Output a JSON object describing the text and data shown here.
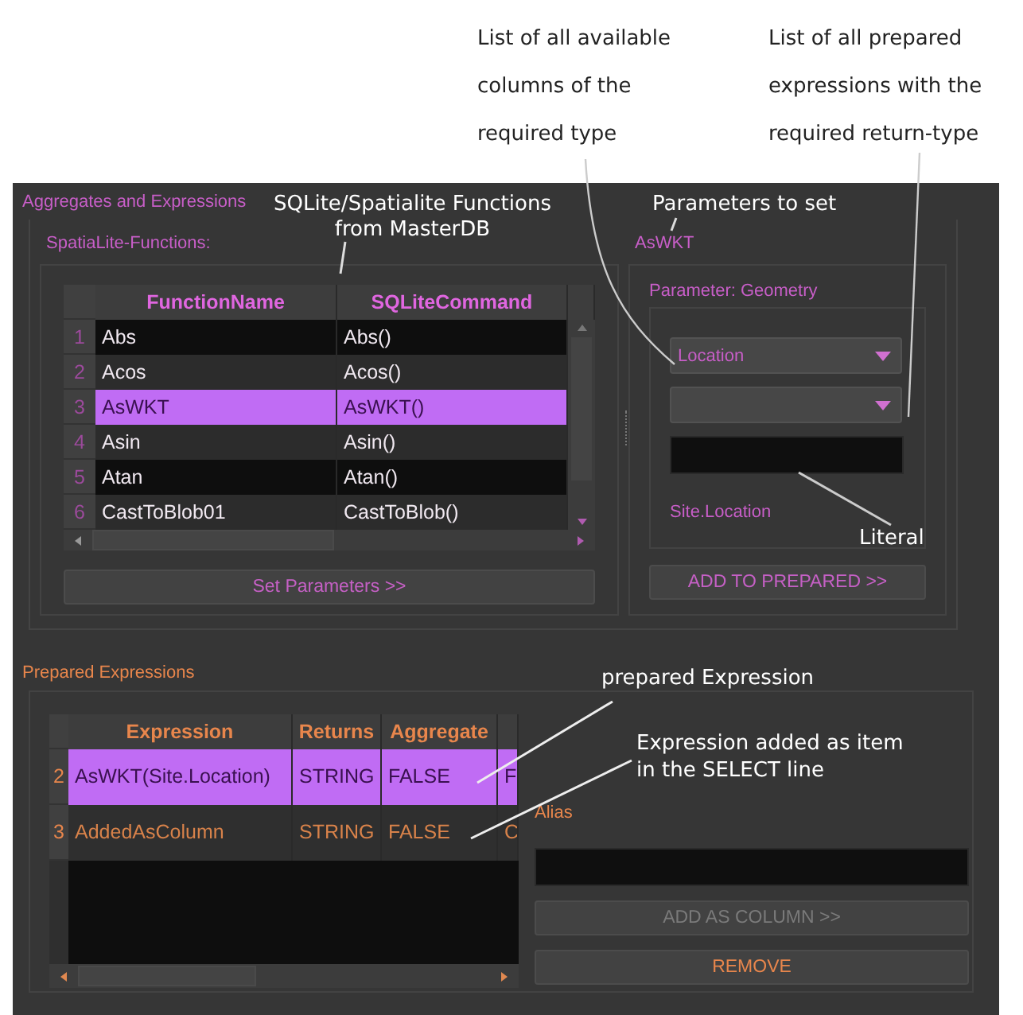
{
  "annotations": [
    {
      "lines": [
        "List of all available",
        "columns of the",
        "required type"
      ]
    },
    {
      "lines": [
        "List of all prepared",
        "expressions with the",
        "required return-type"
      ]
    },
    {
      "lines": [
        "SQLite/Spatialite Functions",
        "from MasterDB"
      ]
    },
    {
      "lines": [
        "Parameters to set"
      ]
    },
    {
      "lines": [
        "Literal"
      ]
    },
    {
      "lines": [
        "prepared Expression"
      ]
    },
    {
      "lines": [
        "Expression added as item",
        "in the SELECT line"
      ]
    }
  ],
  "window": {
    "title": "Aggregates and Expressions"
  },
  "functions": {
    "label": "SpatiaLite-Functions:",
    "columns": [
      "FunctionName",
      "SQLiteCommand"
    ],
    "rows": [
      {
        "num": "1",
        "name": "Abs",
        "command": "Abs()",
        "selected": false
      },
      {
        "num": "2",
        "name": "Acos",
        "command": "Acos()",
        "selected": false
      },
      {
        "num": "3",
        "name": "AsWKT",
        "command": "AsWKT()",
        "selected": true
      },
      {
        "num": "4",
        "name": "Asin",
        "command": "Asin()",
        "selected": false
      },
      {
        "num": "5",
        "name": "Atan",
        "command": "Atan()",
        "selected": false
      },
      {
        "num": "6",
        "name": "CastToBlob01",
        "command": "CastToBlob()",
        "selected": false
      }
    ],
    "button": "Set Parameters >>"
  },
  "parameters": {
    "title": "AsWKT",
    "label": "Parameter: Geometry",
    "column_combo": {
      "value": "Location"
    },
    "source": "Site.Location",
    "button": "ADD TO PREPARED >>"
  },
  "prepared": {
    "title": "Prepared Expressions",
    "columns": [
      "Expression",
      "Returns",
      "Aggregate"
    ],
    "rows": [
      {
        "num": "2",
        "expression": "AsWKT(Site.Location)",
        "returns": "STRING",
        "aggregate": "FALSE",
        "column_4": "F",
        "selected": true
      },
      {
        "num": "3",
        "expression": "AddedAsColumn",
        "returns": "STRING",
        "aggregate": "FALSE",
        "column_4": "C",
        "selected": false
      }
    ],
    "alias_label": "Alias",
    "buttons": [
      {
        "label": "ADD AS COLUMN >>",
        "disabled": true
      },
      {
        "label": "REMOVE",
        "disabled": false
      }
    ]
  }
}
